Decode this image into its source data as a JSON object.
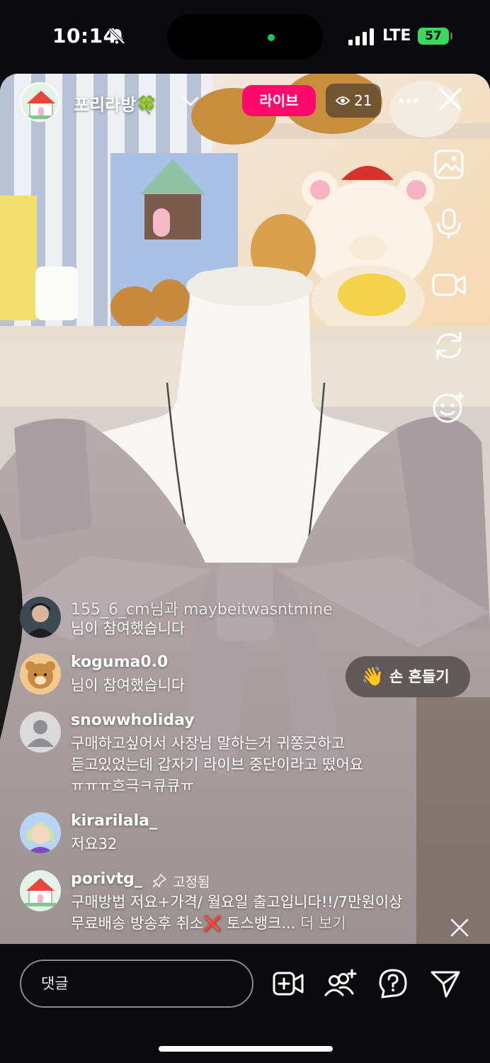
{
  "status_bar": {
    "time": "10:14",
    "network": "LTE",
    "battery": "57"
  },
  "live": {
    "host_name": "포리라방",
    "host_emoji": "🍀",
    "live_label": "라이브",
    "viewer_count": "21"
  },
  "comments": [
    {
      "user": "155_6_cm님과 maybeitwasntmine",
      "lines": [
        "님이 참여했습니다"
      ],
      "avatar": "profile-photo"
    },
    {
      "user": "koguma0.0",
      "lines": [
        "님이 참여했습니다"
      ],
      "avatar": "bear-character"
    },
    {
      "user": "snowwholiday",
      "lines": [
        "구매하고싶어서 사장님 말하는거 귀쫑긋하고",
        "듣고있었는데 갑자기 라이브 중단이라고 떴어요",
        "ㅠㅠㅠ흐극ㅋ큐큐ㅠ"
      ],
      "avatar": "default-person"
    },
    {
      "user": "kirarilala_",
      "lines": [
        "저요32"
      ],
      "avatar": "anime-character"
    },
    {
      "user": "porivtg_",
      "pinned_label": "고정됨",
      "lines": [
        "구매방법 저요+가격/ 월요일 출고입니다!!/7만원이상",
        "무료배송 방송후 취소❌ 토스뱅크..."
      ],
      "more_label": "더 보기",
      "avatar": "house-logo"
    }
  ],
  "wave_button": {
    "emoji": "👋",
    "label": "손 흔들기"
  },
  "bottom_bar": {
    "comment_placeholder": "댓글"
  },
  "colors": {
    "live_badge": "#ff0a6c",
    "battery": "#3fd65c",
    "background": "#0b0b0f"
  },
  "icons": [
    "bell-slash-icon",
    "signal-icon",
    "chevron-down-icon",
    "eye-icon",
    "more-icon",
    "close-icon",
    "gallery-icon",
    "microphone-icon",
    "video-camera-icon",
    "flip-camera-icon",
    "effects-icon",
    "pin-icon",
    "add-video-icon",
    "add-guest-icon",
    "question-icon",
    "send-icon"
  ]
}
